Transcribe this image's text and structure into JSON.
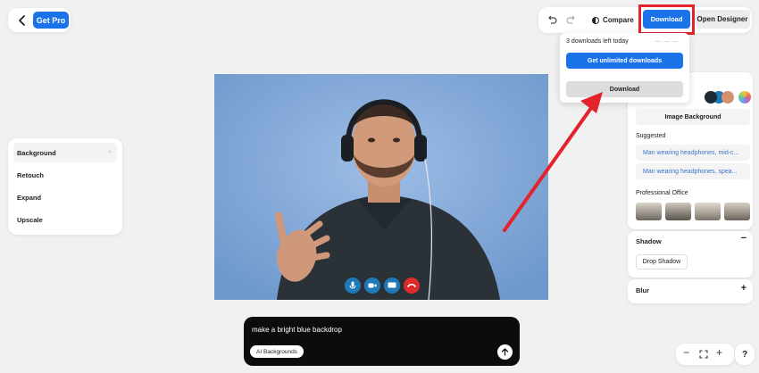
{
  "header": {
    "get_pro_label": "Get Pro",
    "compare_label": "Compare",
    "download_label": "Download",
    "open_designer_label": "Open Designer"
  },
  "download_dropdown": {
    "downloads_left_text": "3 downloads left today",
    "unlimited_button_label": "Get unlimited downloads",
    "download_button_label": "Download"
  },
  "left_menu": {
    "items": [
      {
        "label": "Background",
        "active": true
      },
      {
        "label": "Retouch"
      },
      {
        "label": "Expand"
      },
      {
        "label": "Upscale"
      }
    ]
  },
  "prompt": {
    "text": "make a  bright blue backdrop",
    "chip_label": "AI Backgrounds"
  },
  "right_panel": {
    "swatch_colors": [
      "#1f79b7",
      "#1d2b36",
      "#d49070"
    ],
    "image_background_label": "Image Background",
    "suggested_label": "Suggested",
    "suggestions": [
      "Man wearing headphones, mid-c...",
      "Man wearing headphones, spea..."
    ],
    "professional_office_label": "Professional Office",
    "shadow_label": "Shadow",
    "shadow_toggle": "−",
    "drop_shadow_label": "Drop Shadow",
    "blur_label": "Blur",
    "blur_toggle": "+"
  },
  "zoom_controls": {
    "zoom_out": "−",
    "zoom_in": "+",
    "help": "?"
  },
  "colors": {
    "accent_blue": "#1a73e8",
    "highlight_red": "#e3232c"
  }
}
